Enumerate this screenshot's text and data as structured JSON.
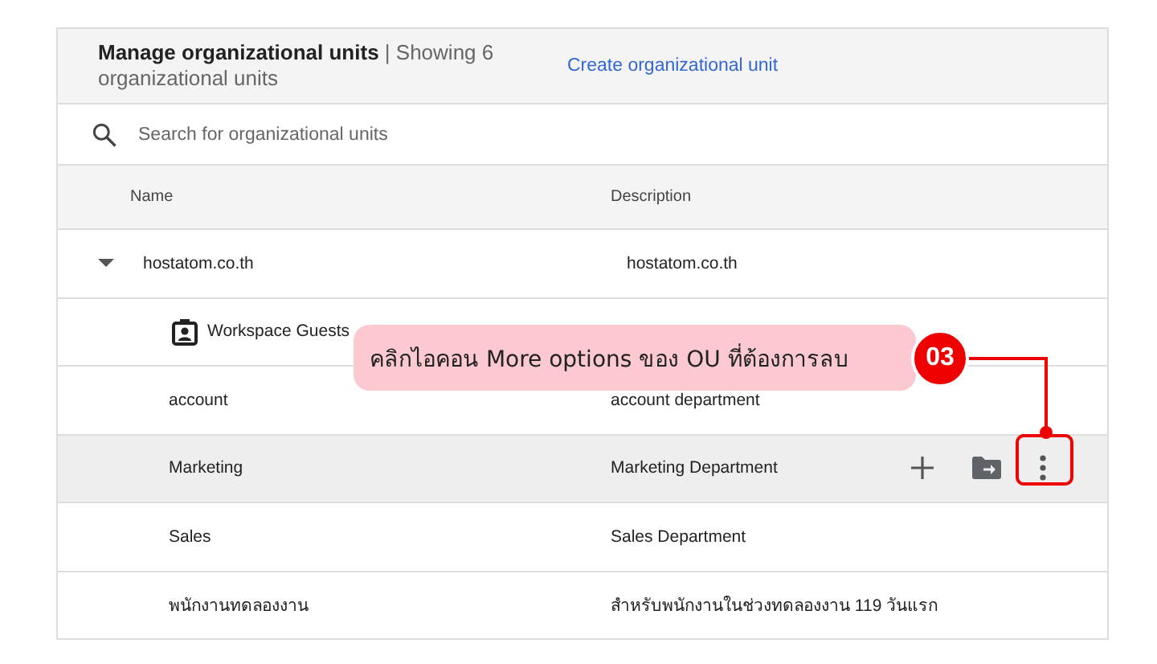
{
  "header": {
    "title": "Manage organizational units",
    "count": "| Showing 6 organizational units",
    "create_link": "Create organizational unit"
  },
  "search": {
    "placeholder": "Search for organizational units"
  },
  "table": {
    "columns": [
      "Name",
      "Description"
    ],
    "rows": [
      {
        "name": "hostatom.co.th",
        "description": "hostatom.co.th",
        "selected": false,
        "expanded": true,
        "children": [
          {
            "name": "Workspace Guests",
            "kind": "guest",
            "selected": false
          },
          {
            "name": "account",
            "description": "account department",
            "selected": false
          },
          {
            "name": "Marketing",
            "description": "Marketing Department",
            "selected": true
          },
          {
            "name": "Sales",
            "description": "Sales Department",
            "selected": false
          },
          {
            "name": "พนักงานทดลองงาน",
            "description": "สำหรับพนักงานในช่วงทดลองงาน 119 วันแรก",
            "selected": false
          }
        ]
      }
    ]
  },
  "callout": {
    "text": "คลิกไอคอน More options ของ OU ที่ต้องการลบ",
    "step": "03"
  }
}
